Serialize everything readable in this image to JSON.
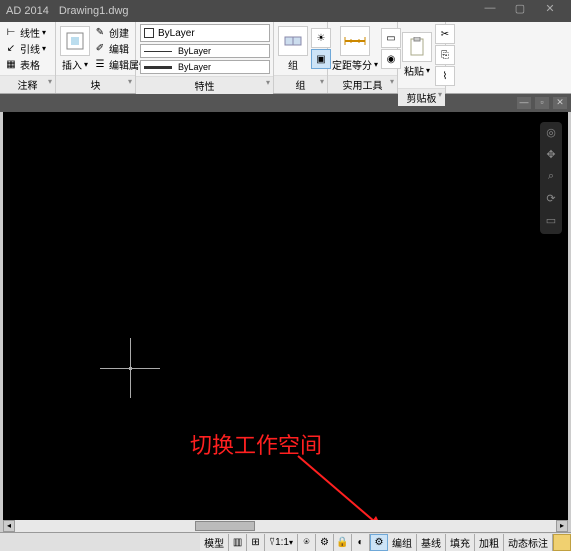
{
  "titlebar": {
    "app": "AD 2014",
    "doc": "Drawing1.dwg",
    "min": "—",
    "max": "▢",
    "close": "✕"
  },
  "ribbon": {
    "annotate": {
      "linear": "线性",
      "leader": "引线",
      "table": "表格",
      "panel": "注释"
    },
    "insert": {
      "btn": "插入",
      "create": "创建",
      "edit": "编辑",
      "editattr": "编辑属性",
      "panel": "块"
    },
    "properties": {
      "layer": "ByLayer",
      "line1": "ByLayer",
      "line2": "ByLayer",
      "panel": "特性"
    },
    "group": {
      "btn": "组",
      "panel": "组"
    },
    "util": {
      "measure": "定距等分",
      "panel": "实用工具"
    },
    "clipboard": {
      "paste": "粘贴",
      "panel": "剪贴板"
    }
  },
  "annotation_text": "切换工作空间",
  "statusbar": {
    "model": "模型",
    "scale": "1:1",
    "grp": "编组",
    "base": "基线",
    "fill": "填充",
    "thick": "加粗",
    "dyn": "动态标注"
  }
}
